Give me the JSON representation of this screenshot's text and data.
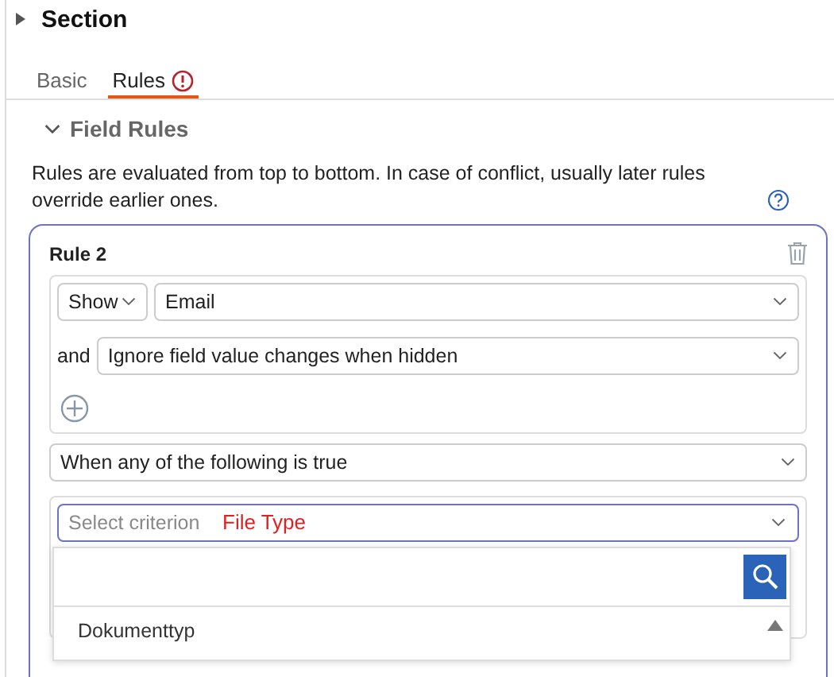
{
  "section": {
    "title": "Section",
    "expanded": false
  },
  "tabs": [
    {
      "label": "Basic",
      "selected": false,
      "error": false
    },
    {
      "label": "Rules",
      "selected": true,
      "error": true
    }
  ],
  "field_rules": {
    "title": "Field Rules",
    "expanded": true,
    "description": "Rules are evaluated from top to bottom. In case of conflict, usually later rules override earlier ones."
  },
  "rule": {
    "title": "Rule 2",
    "action": "Show",
    "field": "Email",
    "option_prefix": "and",
    "option": "Ignore field value changes when hidden",
    "condition": "When any of the following is true",
    "criterion": {
      "placeholder": "Select criterion",
      "annotation": "File Type",
      "items": [
        "Dokumenttyp"
      ]
    }
  }
}
